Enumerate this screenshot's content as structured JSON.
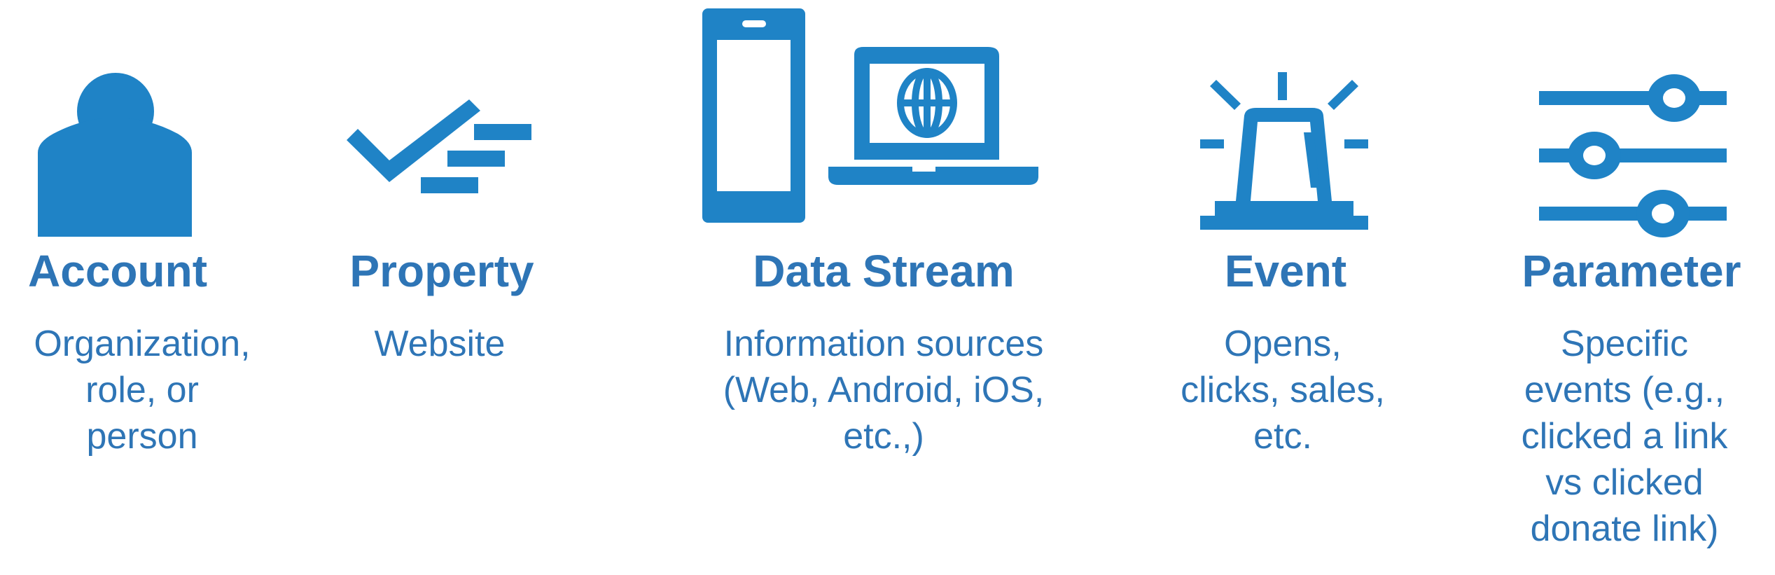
{
  "colors": {
    "icon": "#1f83c6",
    "text": "#2e75b6",
    "background": "#ffffff"
  },
  "items": [
    {
      "icon": "person-icon",
      "title": "Account",
      "description": "Organization,\nrole, or\nperson"
    },
    {
      "icon": "checklist-icon",
      "title": "Property",
      "description": "Website"
    },
    {
      "icon": "devices-icon",
      "title": "Data Stream",
      "description": "Information sources\n(Web, Android, iOS,\netc.,)"
    },
    {
      "icon": "siren-icon",
      "title": "Event",
      "description": "Opens,\nclicks, sales,\netc."
    },
    {
      "icon": "sliders-icon",
      "title": "Parameter",
      "description": "Specific\nevents (e.g.,\nclicked a link\nvs clicked\ndonate link)"
    }
  ]
}
